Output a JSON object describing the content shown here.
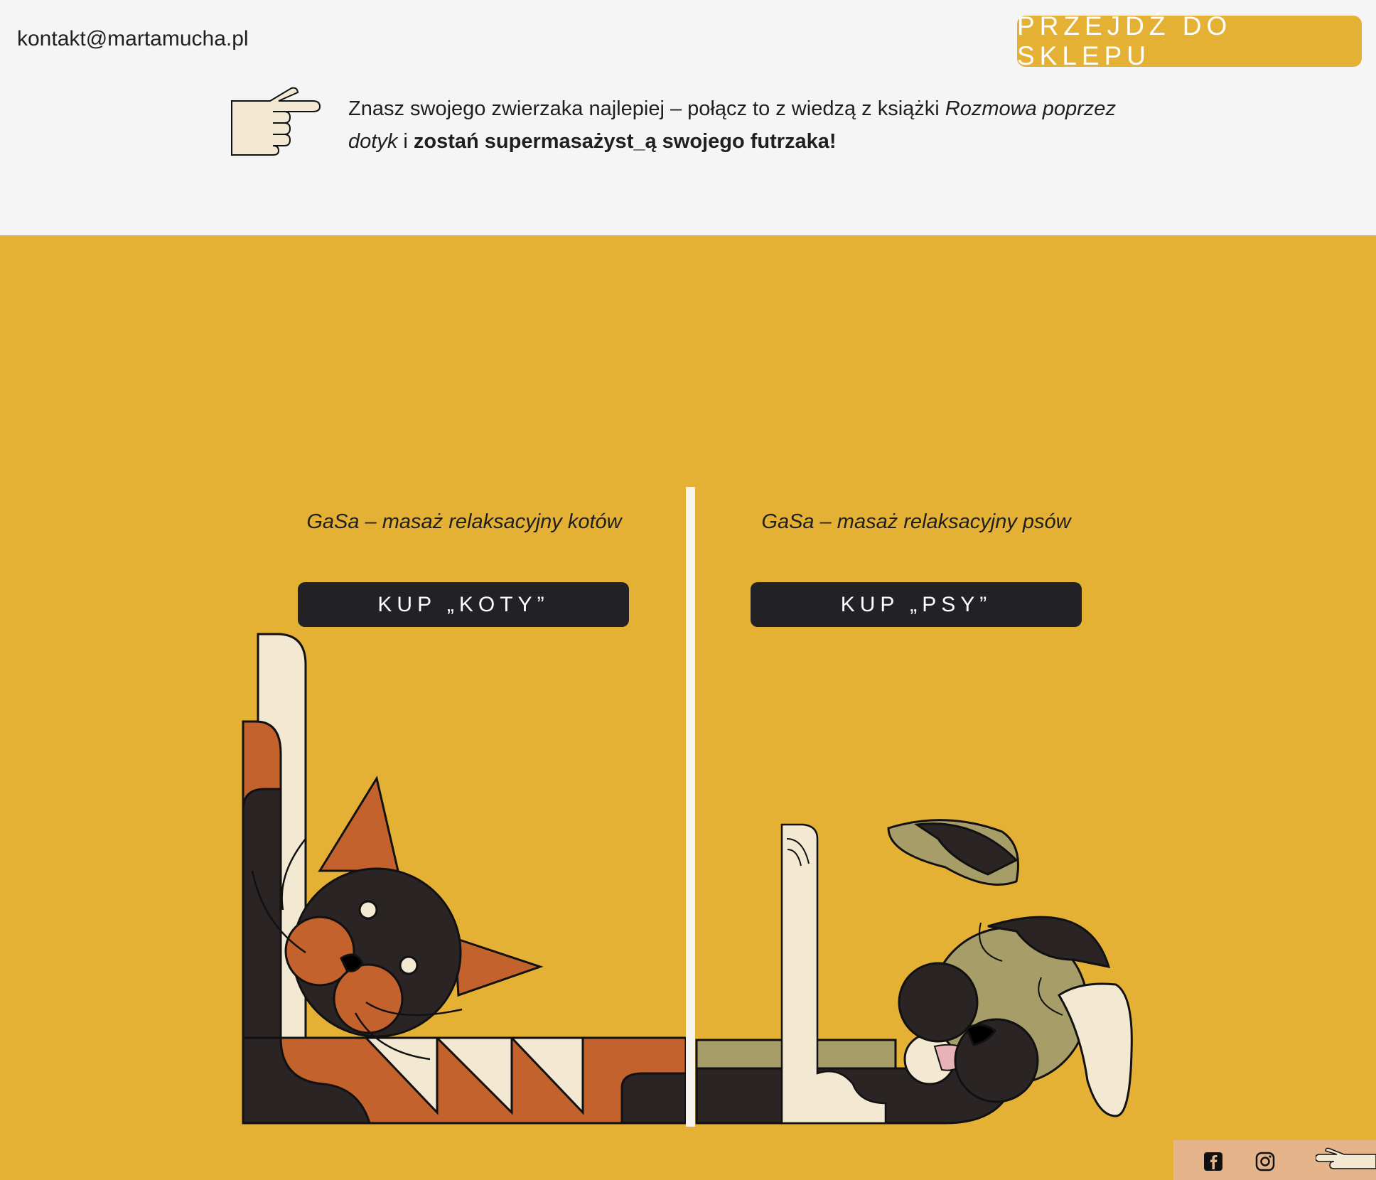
{
  "header": {
    "email": "kontakt@martamucha.pl",
    "shop_button": "PRZEJDŹ DO SKLEPU"
  },
  "intro": {
    "text_1": "Znasz swojego zwierzaka najlepiej – połącz to z wiedzą z książki ",
    "book_title": "Rozmowa poprzez dotyk",
    "text_2": " i ",
    "bold_text": "zostań supermasażyst_ą swojego futrzaka!"
  },
  "products": {
    "cats": {
      "subtitle": "GaSa – masaż relaksacyjny kotów",
      "button": "KUP „KOTY”"
    },
    "dogs": {
      "subtitle": "GaSa – masaż relaksacyjny psów",
      "button": "KUP „PSY”"
    }
  },
  "footer": {
    "icons": [
      "facebook-icon",
      "instagram-icon",
      "pointing-hand-icon"
    ]
  },
  "colors": {
    "accent": "#E5B134",
    "dark": "#222125",
    "light": "#F5F5F5",
    "cat_orange": "#C4622D",
    "dog_olive": "#A79D69",
    "cream": "#F3E8D2",
    "footer_bar": "#E6B48A"
  }
}
